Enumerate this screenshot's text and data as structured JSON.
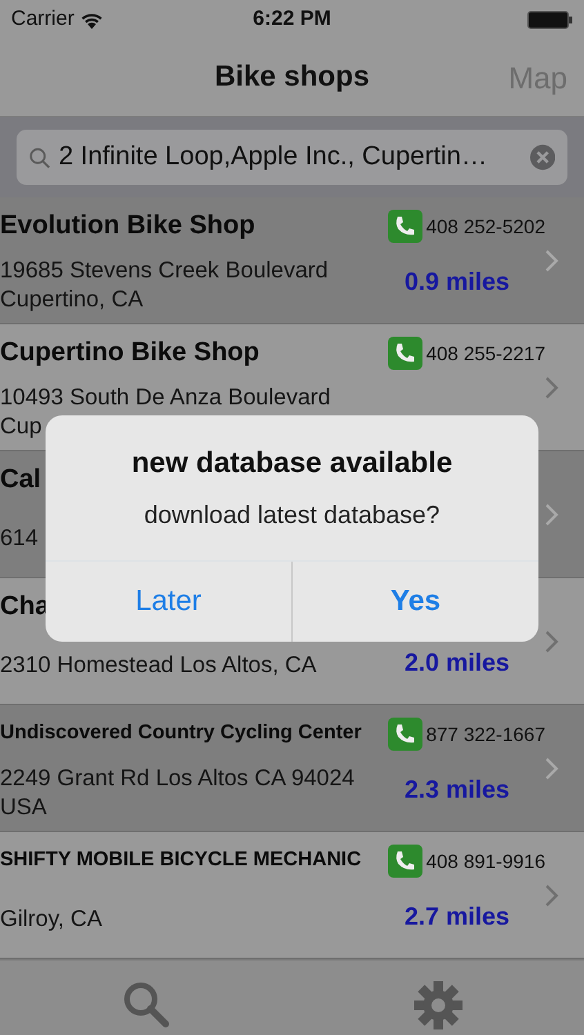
{
  "status_bar": {
    "carrier": "Carrier",
    "time": "6:22 PM"
  },
  "nav": {
    "title": "Bike shops",
    "right_button": "Map"
  },
  "search": {
    "value": "2 Infinite Loop,Apple Inc., Cupertin…"
  },
  "shops": [
    {
      "name": "Evolution Bike Shop",
      "phone": "408 252-5202",
      "address": [
        "19685 Stevens Creek Boulevard",
        "Cupertino, CA"
      ],
      "distance": "0.9 miles"
    },
    {
      "name": "Cupertino Bike Shop",
      "phone": "408 255-2217",
      "address": [
        "10493 South De Anza Boulevard",
        "Cup"
      ]
    },
    {
      "name": "Cal",
      "address": [
        "614"
      ]
    },
    {
      "name": "Cha",
      "address": [
        "2310 Homestead Los Altos, CA"
      ],
      "distance": "2.0 miles"
    },
    {
      "name": "Undiscovered Country Cycling Center",
      "phone": "877 322-1667",
      "address": [
        "2249 Grant Rd Los Altos CA 94024",
        "USA"
      ],
      "distance": "2.3 miles"
    },
    {
      "name": "SHIFTY MOBILE BICYCLE MECHANIC",
      "phone": "408 891-9916",
      "address": [
        "Gilroy, CA"
      ],
      "distance": "2.7 miles"
    }
  ],
  "alert": {
    "title": "new database available",
    "message": "download latest database?",
    "buttons": [
      "Later",
      "Yes"
    ]
  }
}
